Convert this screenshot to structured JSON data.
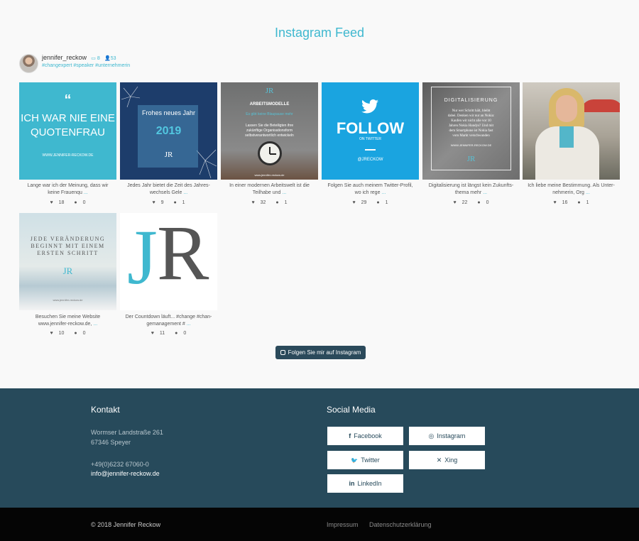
{
  "feed": {
    "title": "Instagram Feed",
    "profile": {
      "username": "jennifer_reckow",
      "posts": "8",
      "followers": "53",
      "tags": "#changexpert #speaker #unternehmerin"
    },
    "posts": [
      {
        "caption_line1": "Lange war ich der Meinung, dass wir",
        "caption_line2": "keine Frauenqu",
        "more": "...",
        "likes": "18",
        "comments": "0",
        "tile": {
          "quote_mark": "“",
          "line1": "ICH WAR NIE EINE",
          "line2": "QUOTENFRAU",
          "url": "WWW.JENNIFER-RECKOW.DE"
        }
      },
      {
        "caption_line1": "Jedes Jahr bietet die Zeit des Jahres-",
        "caption_line2": "wechsels Gele",
        "more": "...",
        "likes": "9",
        "comments": "1",
        "tile": {
          "line1": "Frohes neues Jahr",
          "line2": "2019",
          "mark": "JR"
        }
      },
      {
        "caption_line1": "In einer modernen Arbeitswelt ist die",
        "caption_line2": "Teilhabe und",
        "more": "...",
        "likes": "32",
        "comments": "1",
        "tile": {
          "mark": "JR",
          "line1": "ARBEITSMODELLE",
          "line2": "Es gibt keine Blaupause mehr",
          "line3": "Lassen Sie die Beteiligten ihre",
          "line4": "zukünftige Organisationsform",
          "line5": "selbstverantwortlich entwickeln",
          "url": "www.jennifer-reckow.de"
        }
      },
      {
        "caption_line1": "Folgen Sie auch meinem Twitter-Profil,",
        "caption_line2": "wo ich rege",
        "more": "...",
        "likes": "29",
        "comments": "1",
        "tile": {
          "line1": "FOLLOW",
          "line2": "ON TWITTER",
          "line3": "@JRECKOW"
        }
      },
      {
        "caption_line1": "Digitalisierung ist längst kein Zukunfts-",
        "caption_line2": "thema mehr",
        "more": "...",
        "likes": "22",
        "comments": "0",
        "tile": {
          "line1": "DIGITALISIERUNG",
          "line2": "Nur wer Schritt hält, bleibt",
          "line3": "dabei. Denken wir nur an Nokia:",
          "line4": "Kaufen wir nicht alle vor 10",
          "line5": "Jahren Nokia Handys? Und mit",
          "line6": "dem Smartphone ist Nokia fast",
          "line7": "vom Markt verschwunden",
          "url": "WWW.JENNIFER-RECKOW.DE",
          "mark": "JR"
        }
      },
      {
        "caption_line1": "Ich liebe meine Bestimmung. Als Unter-",
        "caption_line2": "nehmerin, Org",
        "more": "...",
        "likes": "16",
        "comments": "1",
        "tile": {}
      },
      {
        "caption_line1": "Besuchen Sie meine Website",
        "caption_line2": "www.jennifer-reckow.de,",
        "more": "...",
        "likes": "10",
        "comments": "0",
        "tile": {
          "line1": "JEDE VERÄNDERUNG",
          "line2": "BEGINNT MIT EINEM",
          "line3": "ERSTEN SCHRITT",
          "mark": "JR",
          "url": "www.jennifer-reckow.de"
        }
      },
      {
        "caption_line1": "Der Countdown läuft... #change #chan-",
        "caption_line2": "gemanagement #",
        "more": "...",
        "likes": "11",
        "comments": "0",
        "tile": {
          "mark_j": "J",
          "mark_r": "R"
        }
      }
    ],
    "follow_button": "Folgen Sie mir auf Instagram"
  },
  "footer": {
    "contact_heading": "Kontakt",
    "street": "Wormser Landstraße 261",
    "city": "67346 Speyer",
    "phone": "+49(0)6232 67060-0",
    "email": "info@jennifer-reckow.de",
    "social_heading": "Social Media",
    "social": [
      {
        "label": "Facebook",
        "icon": "f"
      },
      {
        "label": "Instagram",
        "icon": "◎"
      },
      {
        "label": "Twitter",
        "icon": "🐦"
      },
      {
        "label": "Xing",
        "icon": "✕"
      },
      {
        "label": "LinkedIn",
        "icon": "in"
      }
    ]
  },
  "bottom": {
    "copyright": "© 2018 Jennifer Reckow",
    "impressum": "Impressum",
    "privacy": "Datenschutzerklärung"
  },
  "colors": {
    "accent": "#3fb8cf",
    "footer_bg": "#274a5b",
    "bottom_bg": "#050505",
    "button_bg": "#2b4a5b"
  }
}
